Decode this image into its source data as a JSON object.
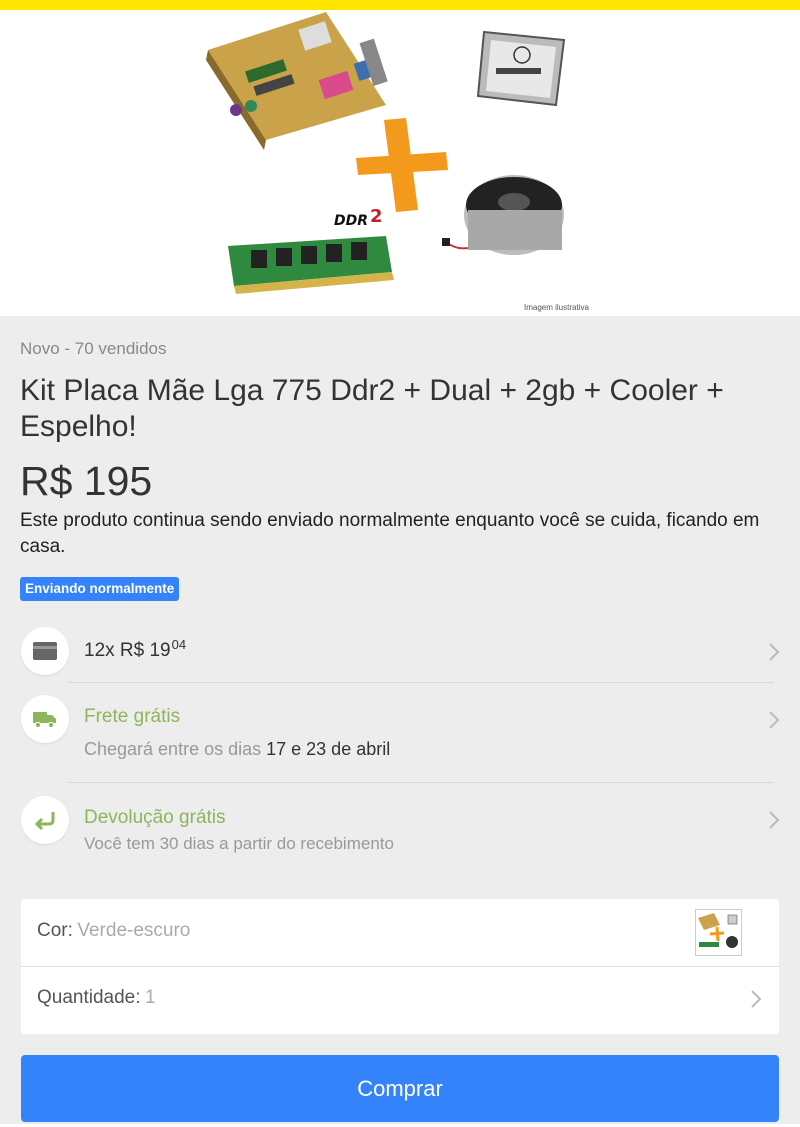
{
  "brand": {
    "accent": "#ffe600",
    "primary": "#3483fa",
    "success": "#8db55b"
  },
  "product": {
    "image_caption": "Imagem ilustrativa",
    "condition": "Novo - 70 vendidos",
    "title": "Kit Placa Mãe Lga 775 Ddr2 + Dual + 2gb + Cooler + Espelho!",
    "price": "R$ 195",
    "shipping_notice": "Este produto continua sendo enviado normalmente enquanto você se cuida, ficando em casa.",
    "badge": "Enviando normalmente"
  },
  "installments": {
    "icon": "credit-card-icon",
    "main": "12x R$ 19",
    "cents": "04"
  },
  "shipping": {
    "icon": "truck-icon",
    "title": "Frete grátis",
    "eta_prefix": "Chegará entre os dias",
    "eta_dates": "17 e 23 de abril"
  },
  "returns": {
    "icon": "return-arrow-icon",
    "title": "Devolução grátis",
    "subtitle": "Você tem 30 dias a partir do recebimento"
  },
  "options": {
    "color_label": "Cor:",
    "color_value": "Verde-escuro",
    "quantity_label": "Quantidade:",
    "quantity_value": "1"
  },
  "buy_button": "Comprar"
}
